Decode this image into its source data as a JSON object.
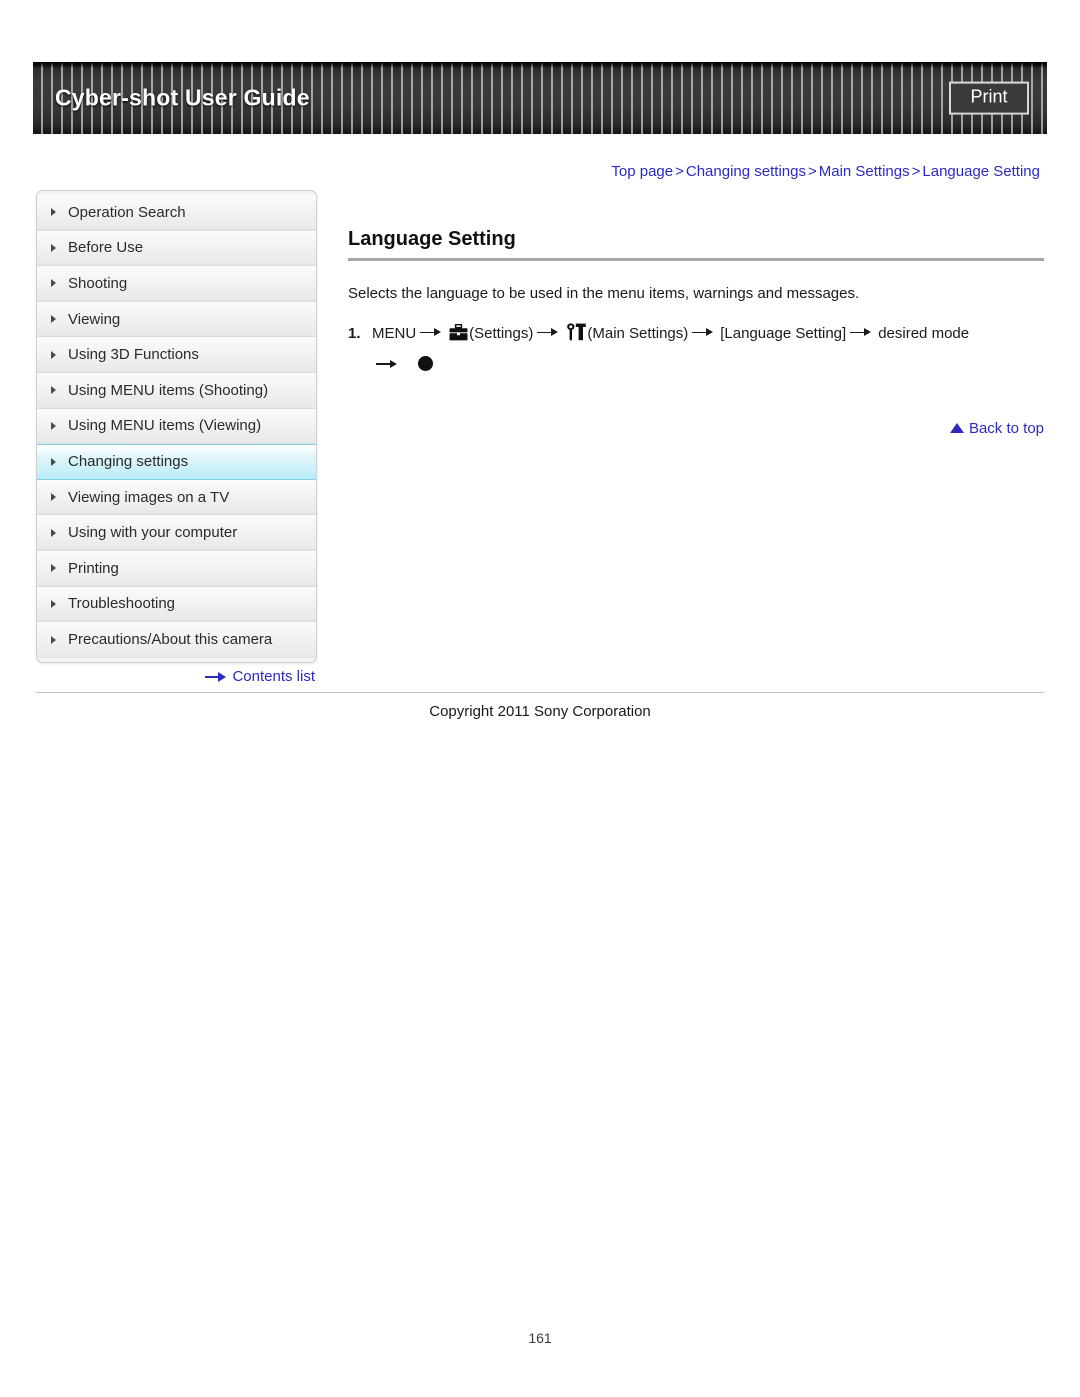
{
  "header": {
    "title": "Cyber-shot User Guide",
    "print_label": "Print"
  },
  "breadcrumb": {
    "items": [
      "Top page",
      "Changing settings",
      "Main Settings",
      "Language Setting"
    ],
    "separator": ">"
  },
  "sidebar": {
    "items": [
      {
        "label": "Operation Search",
        "active": false
      },
      {
        "label": "Before Use",
        "active": false
      },
      {
        "label": "Shooting",
        "active": false
      },
      {
        "label": "Viewing",
        "active": false
      },
      {
        "label": "Using 3D Functions",
        "active": false
      },
      {
        "label": "Using MENU items (Shooting)",
        "active": false
      },
      {
        "label": "Using MENU items (Viewing)",
        "active": false
      },
      {
        "label": "Changing settings",
        "active": true
      },
      {
        "label": "Viewing images on a TV",
        "active": false
      },
      {
        "label": "Using with your computer",
        "active": false
      },
      {
        "label": "Printing",
        "active": false
      },
      {
        "label": "Troubleshooting",
        "active": false
      },
      {
        "label": "Precautions/About this camera",
        "active": false
      }
    ],
    "contents_link": "Contents list"
  },
  "main": {
    "title": "Language Setting",
    "intro": "Selects the language to be used in the menu items, warnings and messages.",
    "step": {
      "number": "1.",
      "menu_label": "MENU",
      "settings_label": "(Settings)",
      "main_settings_label": "(Main Settings)",
      "bracket_label": "[Language Setting]",
      "desired_label": "desired mode",
      "settings_icon": "toolbox-icon",
      "main_settings_icon": "wrench-toolbox-icon",
      "confirm_icon": "center-button-dot-icon"
    },
    "back_to_top": "Back to top"
  },
  "footer": {
    "copyright": "Copyright 2011 Sony Corporation",
    "page_number": "161"
  },
  "colors": {
    "link": "#2b2bbd",
    "active_nav": "#b8ecf6",
    "header_dark": "#2e2e2e"
  }
}
